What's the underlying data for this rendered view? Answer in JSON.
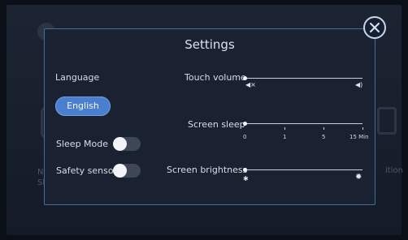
{
  "dialog": {
    "title": "Settings",
    "close_icon": "close-icon"
  },
  "background": {
    "left_text": "Ne\nSh",
    "right_text": "ition"
  },
  "left": {
    "language_label": "Language",
    "language_value": "English",
    "sleep_mode_label": "Sleep Mode",
    "sleep_mode_on": false,
    "safety_sensor_label": "Safety sensor",
    "safety_sensor_on": false
  },
  "right": {
    "touch_volume_label": "Touch volume",
    "touch_volume_level": 0,
    "screen_sleep_label": "Screen sleep",
    "screen_sleep_ticks": [
      "0",
      "1",
      "5",
      "15 Min"
    ],
    "screen_sleep_selected": "0",
    "screen_brightness_label": "Screen brightness",
    "screen_brightness_level": 0
  },
  "colors": {
    "accent": "#4a7fd0",
    "border": "#3f6f9a"
  }
}
